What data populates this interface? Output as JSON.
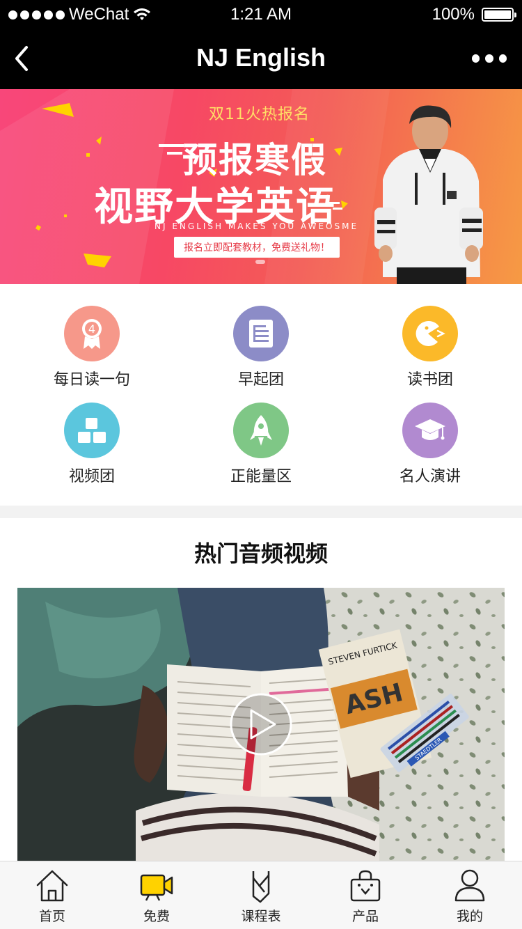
{
  "status_bar": {
    "carrier": "WeChat",
    "time": "1:21 AM",
    "battery": "100%"
  },
  "nav": {
    "title": "NJ English"
  },
  "banner": {
    "pre_title": "双11火热报名",
    "headline_1": "预报寒假",
    "headline_2": "视野大学英语",
    "tagline_en": "NJ ENGLISH MAKES YOU AWEOSME",
    "promo": "报名立即配套教材，免费送礼物！",
    "colors": {
      "start": "#f8477a",
      "end": "#f69a44"
    }
  },
  "categories": [
    {
      "label": "每日读一句",
      "icon": "badge-4-icon",
      "color": "#f6988a"
    },
    {
      "label": "早起团",
      "icon": "document-icon",
      "color": "#8c8cc7"
    },
    {
      "label": "读书团",
      "icon": "pacman-icon",
      "color": "#fbb929"
    },
    {
      "label": "视频团",
      "icon": "blocks-icon",
      "color": "#5bc6dd"
    },
    {
      "label": "正能量区",
      "icon": "rocket-icon",
      "color": "#7fc786"
    },
    {
      "label": "名人演讲",
      "icon": "graduation-cap-icon",
      "color": "#b18ad0"
    }
  ],
  "hot_section": {
    "title": "热门音频视频",
    "book_author": "STEVEN FURTICK",
    "pen_brand": "STAEDTLER"
  },
  "tab_bar": [
    {
      "label": "首页",
      "icon": "home-icon"
    },
    {
      "label": "免费",
      "icon": "video-camera-icon"
    },
    {
      "label": "课程表",
      "icon": "schedule-icon"
    },
    {
      "label": "产品",
      "icon": "shopping-bag-icon"
    },
    {
      "label": "我的",
      "icon": "user-icon"
    }
  ]
}
